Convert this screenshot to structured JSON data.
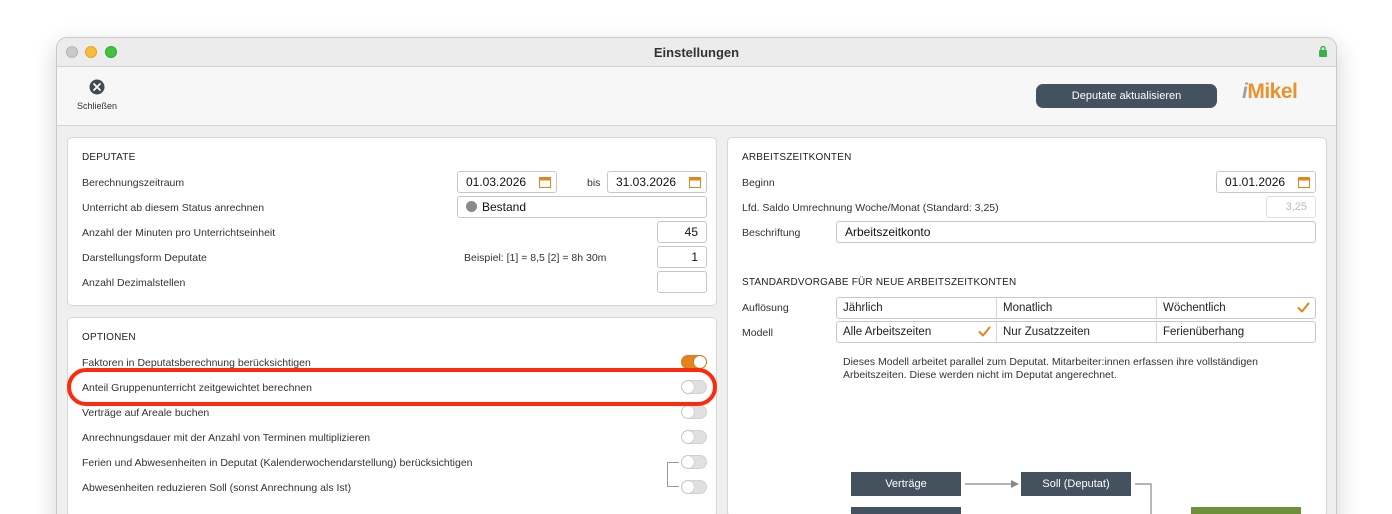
{
  "window": {
    "title": "Einstellungen"
  },
  "toolbar": {
    "close_label": "Schließen",
    "update_label": "Deputate aktualisieren",
    "logo_prefix": "i",
    "logo_text": "Mikel"
  },
  "deputate": {
    "title": "DEPUTATE",
    "calc_period_label": "Berechnungszeitraum",
    "calc_from": "01.03.2026",
    "bis_label": "bis",
    "calc_to": "31.03.2026",
    "status_label": "Unterricht ab diesem Status anrechnen",
    "status_value": "Bestand",
    "minutes_label": "Anzahl der Minuten pro Unterrichtseinheit",
    "minutes_value": "45",
    "display_label": "Darstellungsform Deputate",
    "display_example": "Beispiel:  [1] = 8,5   [2] = 8h 30m",
    "display_value": "1",
    "decimals_label": "Anzahl Dezimalstellen",
    "decimals_value": ""
  },
  "optionen": {
    "title": "OPTIONEN",
    "items": [
      {
        "label": "Faktoren in Deputatsberechnung berücksichtigen",
        "on": true
      },
      {
        "label": "Anteil Gruppenunterricht zeitgewichtet berechnen",
        "on": false
      },
      {
        "label": "Verträge auf Areale buchen",
        "on": false
      },
      {
        "label": "Anrechnungsdauer mit der Anzahl von Terminen multiplizieren",
        "on": false
      },
      {
        "label": "Ferien und Abwesenheiten in Deputat (Kalenderwochendarstellung) berücksichtigen",
        "on": false
      },
      {
        "label": "Abwesenheiten reduzieren Soll (sonst Anrechnung als Ist)",
        "on": false
      }
    ]
  },
  "arbeitszeit": {
    "title": "ARBEITSZEITKONTEN",
    "beginn_label": "Beginn",
    "beginn_value": "01.01.2026",
    "saldo_label": "Lfd. Saldo Umrechnung Woche/Monat (Standard: 3,25)",
    "saldo_value": "3,25",
    "beschriftung_label": "Beschriftung",
    "beschriftung_value": "Arbeitszeitkonto",
    "std_title": "STANDARDVORGABE FÜR NEUE ARBEITSZEITKONTEN",
    "aufloesung_label": "Auflösung",
    "aufloesung_options": [
      "Jährlich",
      "Monatlich",
      "Wöchentlich"
    ],
    "aufloesung_selected": "Wöchentlich",
    "modell_label": "Modell",
    "modell_options": [
      "Alle Arbeitszeiten",
      "Nur Zusatzzeiten",
      "Ferienüberhang"
    ],
    "modell_selected": "Alle Arbeitszeiten",
    "description_line1": "Dieses Modell arbeitet parallel zum Deputat. Mitarbeiter:innen erfassen ihre vollständigen",
    "description_line2": "Arbeitszeiten. Diese werden nicht im Deputat angerechnet.",
    "diagram": {
      "box1": "Verträge",
      "box2": "Soll (Deputat)"
    }
  },
  "colors": {
    "accent": "#e3851e",
    "button": "#44525f",
    "highlight": "#ff2a0c",
    "box_green": "#6f8f3a"
  }
}
